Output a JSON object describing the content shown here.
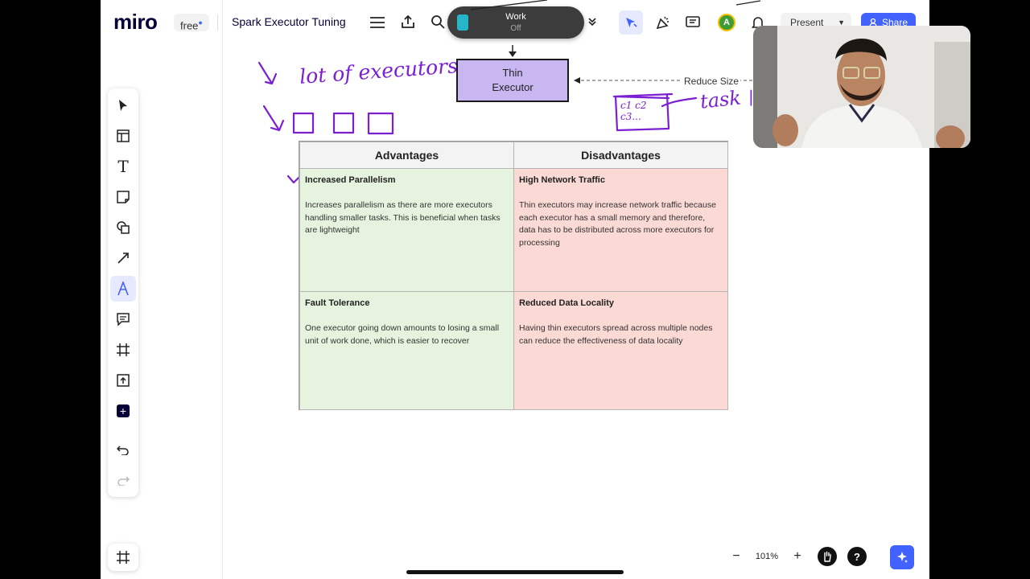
{
  "app": {
    "logo": "miro",
    "plan_badge": "free",
    "board_title": "Spark Executor Tuning",
    "focus": {
      "title": "Work",
      "status": "Off"
    },
    "avatar_initial": "A",
    "present_label": "Present",
    "share_label": "Share"
  },
  "canvas": {
    "sticky_box": {
      "line1": "Thin",
      "line2": "Executor"
    },
    "reduce_label": "Reduce Size",
    "handwriting": {
      "lot_of_executors": "lot of executors",
      "task": "task",
      "cores": "c1 c2 c3..."
    },
    "table": {
      "headers": [
        "Advantages",
        "Disadvantages"
      ],
      "rows": [
        {
          "adv_title": "Increased Parallelism",
          "adv_text": "Increases parallelism as there are more executors handling smaller tasks. This is beneficial when tasks are lightweight",
          "dis_title": "High Network Traffic",
          "dis_text": "Thin executors may increase network traffic because each executor has a small memory and therefore, data has to be distributed across more executors for processing"
        },
        {
          "adv_title": "Fault Tolerance",
          "adv_text": "One executor going down amounts to losing a small unit of work done, which is easier to recover",
          "dis_title": "Reduced Data Locality",
          "dis_text": "Having thin executors spread across multiple nodes can reduce the effectiveness of data locality"
        }
      ]
    }
  },
  "zoom": {
    "level": "101%"
  },
  "colors": {
    "accent": "#4262ff",
    "ink": "#7a1fd1",
    "advantage_bg": "#e6f4df",
    "disadvantage_bg": "#fbd9d5",
    "sticky_bg": "#c9b7f2"
  },
  "icons": {
    "left_toolbar": [
      "select-icon",
      "templates-icon",
      "text-icon",
      "sticky-note-icon",
      "shapes-icon",
      "pen-line-icon",
      "pen-icon",
      "comment-icon",
      "frame-icon",
      "upload-icon",
      "more-apps-icon",
      "undo-icon",
      "redo-icon"
    ]
  }
}
